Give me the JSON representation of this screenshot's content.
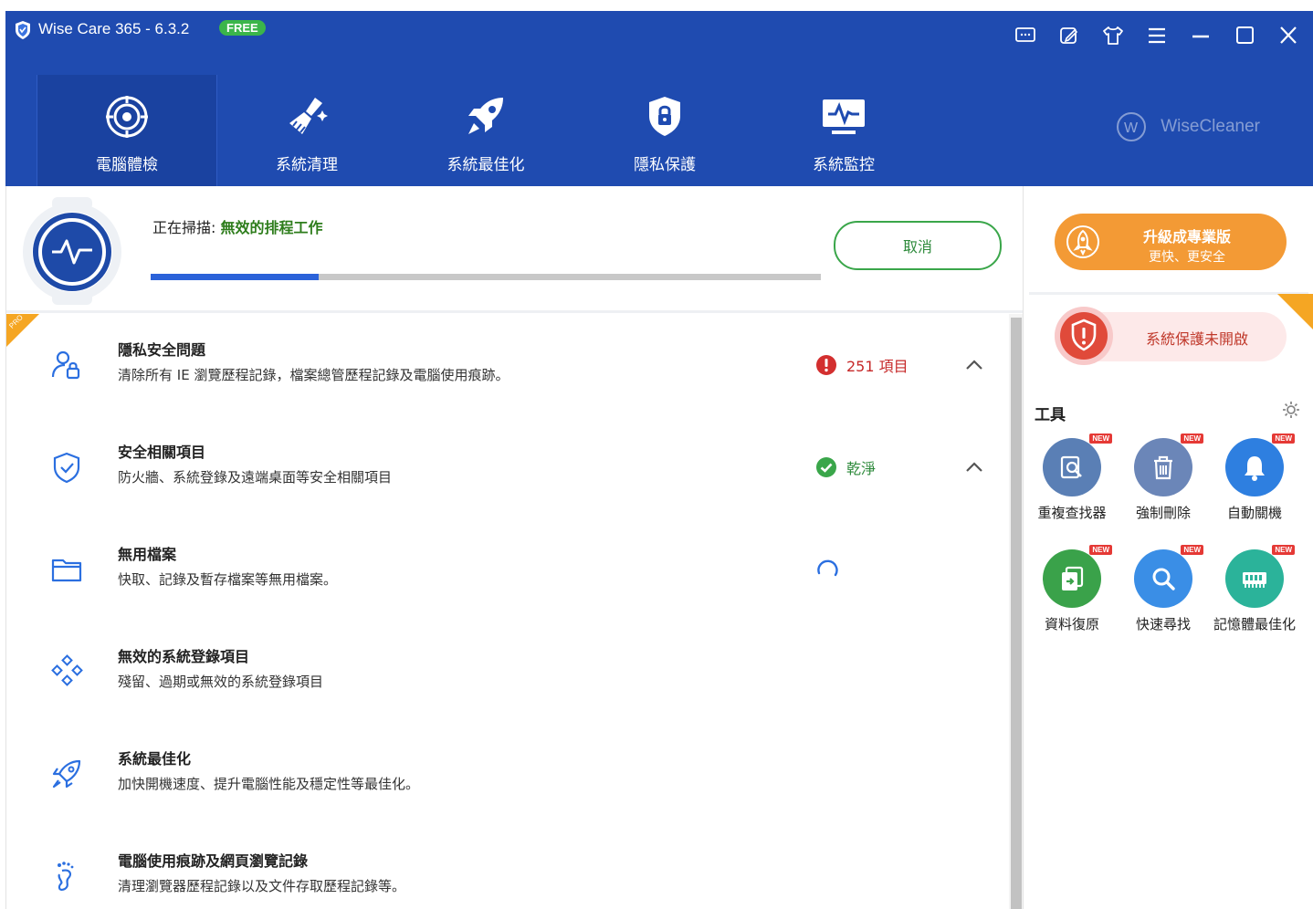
{
  "app": {
    "title": "Wise Care 365 - 6.3.2",
    "badge": "FREE",
    "brand": "WiseCleaner"
  },
  "window_controls": [
    {
      "name": "feedback-icon"
    },
    {
      "name": "edit-icon"
    },
    {
      "name": "skin-icon"
    },
    {
      "name": "menu-icon"
    },
    {
      "name": "minimize-icon"
    },
    {
      "name": "maximize-icon"
    },
    {
      "name": "close-icon"
    }
  ],
  "nav": [
    {
      "label": "電腦體檢",
      "icon": "radar-icon"
    },
    {
      "label": "系統清理",
      "icon": "broom-icon"
    },
    {
      "label": "系統最佳化",
      "icon": "rocket-icon"
    },
    {
      "label": "隱私保護",
      "icon": "lock-shield-icon"
    },
    {
      "label": "系統監控",
      "icon": "monitor-icon"
    }
  ],
  "scan": {
    "prefix": "正在掃描: ",
    "target": "無效的排程工作",
    "progress": 0.25,
    "cancel": "取消"
  },
  "items": [
    {
      "title": "隱私安全問題",
      "desc": "清除所有 IE 瀏覽歷程記錄，檔案總管歷程記錄及電腦使用痕跡。",
      "icon": "user-lock-icon",
      "status": "251 項目",
      "status_type": "issues"
    },
    {
      "title": "安全相關項目",
      "desc": "防火牆、系統登錄及遠端桌面等安全相關項目",
      "icon": "shield-check-icon",
      "status": "乾淨",
      "status_type": "clean"
    },
    {
      "title": "無用檔案",
      "desc": "快取、記錄及暫存檔案等無用檔案。",
      "icon": "folder-icon",
      "status": "",
      "status_type": "loading"
    },
    {
      "title": "無效的系統登錄項目",
      "desc": "殘留、過期或無效的系統登錄項目",
      "icon": "registry-icon",
      "status": "",
      "status_type": "none"
    },
    {
      "title": "系統最佳化",
      "desc": "加快開機速度、提升電腦性能及穩定性等最佳化。",
      "icon": "rocket-outline-icon",
      "status": "",
      "status_type": "none"
    },
    {
      "title": "電腦使用痕跡及網頁瀏覽記錄",
      "desc": "清理瀏覽器歷程記錄以及文件存取歷程記錄等。",
      "icon": "footprint-icon",
      "status": "",
      "status_type": "none"
    }
  ],
  "ribbon": "PRO",
  "upgrade": {
    "line1": "升級成專業版",
    "line2": "更快、更安全"
  },
  "protection": {
    "text": "系統保護未開啟"
  },
  "tools": {
    "header": "工具",
    "new_label": "NEW",
    "items": [
      {
        "label": "重複查找器",
        "icon": "duplicate-finder-icon",
        "color": "#5a7fb5"
      },
      {
        "label": "強制刪除",
        "icon": "trash-icon",
        "color": "#6b86b8"
      },
      {
        "label": "自動關機",
        "icon": "bell-icon",
        "color": "#2e7fe0"
      },
      {
        "label": "資料復原",
        "icon": "data-recovery-icon",
        "color": "#3aa24a"
      },
      {
        "label": "快速尋找",
        "icon": "search-icon",
        "color": "#3a8ee6"
      },
      {
        "label": "記憶體最佳化",
        "icon": "memory-icon",
        "color": "#2bb39a"
      }
    ]
  },
  "colors": {
    "header": "#1f4bb0",
    "accent": "#2b62d9",
    "green": "#3aa64a",
    "orange": "#f39a35",
    "red": "#d32f2f"
  }
}
